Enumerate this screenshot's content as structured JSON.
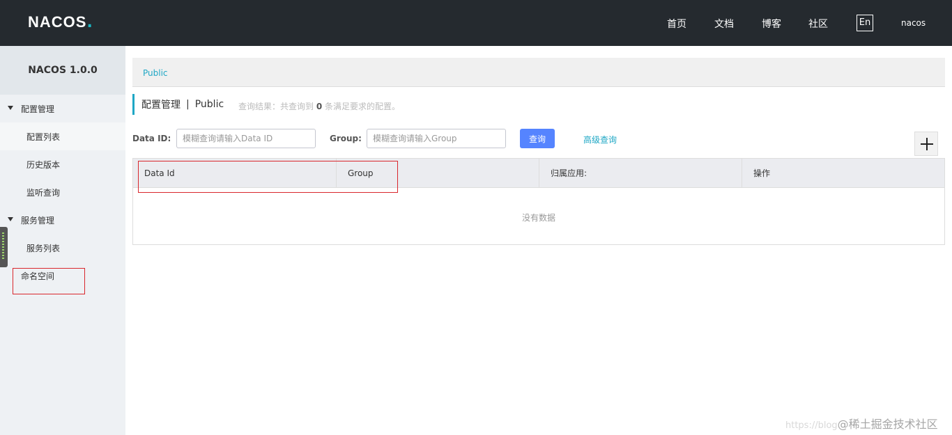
{
  "header": {
    "logo_text": "NACOS",
    "logo_dot": ".",
    "nav": [
      "首页",
      "文档",
      "博客",
      "社区"
    ],
    "lang": "En",
    "user": "nacos"
  },
  "sidebar": {
    "title": "NACOS 1.0.0",
    "groups": [
      {
        "label": "配置管理",
        "items": [
          "配置列表",
          "历史版本",
          "监听查询"
        ]
      },
      {
        "label": "服务管理",
        "items": [
          "服务列表"
        ]
      }
    ],
    "namespace": "命名空间"
  },
  "breadcrumb": {
    "link": "Public"
  },
  "page": {
    "title": "配置管理",
    "sep": "|",
    "sub": "Public",
    "query_prefix": "查询结果：共查询到",
    "query_count": "0",
    "query_suffix": "条满足要求的配置。"
  },
  "search": {
    "dataid_label": "Data ID:",
    "dataid_placeholder": "模糊查询请输入Data ID",
    "group_label": "Group:",
    "group_placeholder": "模糊查询请输入Group",
    "query_button": "查询",
    "advanced": "高级查询"
  },
  "table": {
    "columns": [
      "Data Id",
      "Group",
      "",
      "归属应用:",
      "操作"
    ],
    "empty": "没有数据"
  },
  "watermark": {
    "faint": "https://blog",
    "text": "@稀土掘金技术社区"
  },
  "colors": {
    "accent": "#1ea7c5",
    "primary_button": "#5584ff",
    "header_bg": "#252a2f",
    "annotation": "#d9262c"
  }
}
